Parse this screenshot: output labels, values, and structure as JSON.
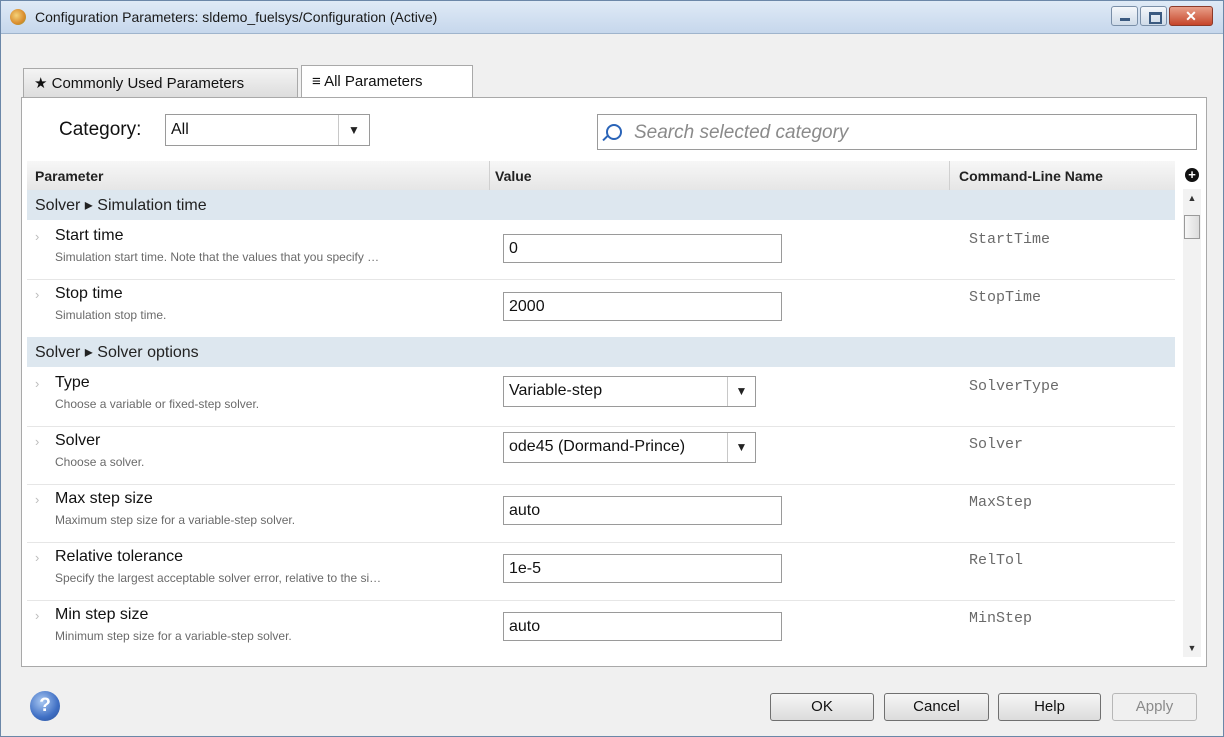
{
  "window": {
    "title": "Configuration Parameters: sldemo_fuelsys/Configuration (Active)",
    "controls": [
      "minimize",
      "maximize",
      "close"
    ]
  },
  "tabs": [
    {
      "label": "★ Commonly Used Parameters",
      "active": false
    },
    {
      "label": "≡ All Parameters",
      "active": true
    }
  ],
  "category": {
    "label": "Category:",
    "selected": "All"
  },
  "search": {
    "placeholder": "Search selected category"
  },
  "table": {
    "headers": {
      "parameter": "Parameter",
      "value": "Value",
      "command": "Command-Line Name"
    },
    "groups": [
      {
        "label": "Solver ▸ Simulation time",
        "rows": [
          {
            "name": "Start time",
            "description": "Simulation start time. Note that the values that you specify …",
            "value": "0",
            "control": "input",
            "command": "StartTime"
          },
          {
            "name": "Stop time",
            "description": "Simulation stop time.",
            "value": "2000",
            "control": "input",
            "command": "StopTime"
          }
        ]
      },
      {
        "label": "Solver ▸ Solver options",
        "rows": [
          {
            "name": "Type",
            "description": "Choose a variable or fixed-step solver.",
            "value": "Variable-step",
            "control": "select",
            "command": "SolverType"
          },
          {
            "name": "Solver",
            "description": "Choose a solver.",
            "value": "ode45 (Dormand-Prince)",
            "control": "select",
            "command": "Solver"
          },
          {
            "name": "Max step size",
            "description": "Maximum step size for a variable-step solver.",
            "value": "auto",
            "control": "input",
            "command": "MaxStep"
          },
          {
            "name": "Relative tolerance",
            "description": "Specify the largest acceptable solver error, relative to the si…",
            "value": "1e-5",
            "control": "input",
            "command": "RelTol"
          },
          {
            "name": "Min step size",
            "description": "Minimum step size for a variable-step solver.",
            "value": "auto",
            "control": "input",
            "command": "MinStep"
          }
        ]
      }
    ]
  },
  "buttons": {
    "ok": "OK",
    "cancel": "Cancel",
    "help": "Help",
    "apply": "Apply"
  },
  "icons": {
    "help": "help-icon",
    "search": "search-icon",
    "add_column": "add-column-icon"
  }
}
